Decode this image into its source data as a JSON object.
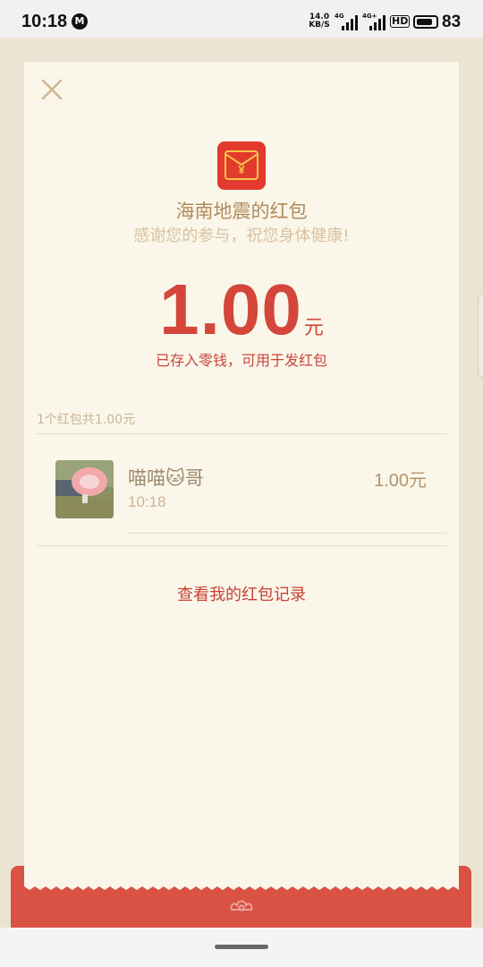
{
  "status_bar": {
    "time": "10:18",
    "app_icon_letter": "M",
    "net_speed_value": "14.0",
    "net_speed_unit": "KB/S",
    "sim1_tag": "4G",
    "sim2_tag": "4G+",
    "hd_label": "HD",
    "battery_level": 83,
    "battery_text": "83"
  },
  "red_packet": {
    "title": "海南地震的红包",
    "greeting": "感谢您的参与，祝您身体健康!",
    "amount": "1.00",
    "amount_unit": "元",
    "deposit_note": "已存入零钱，可用于发红包",
    "summary": "1个红包共1.00元"
  },
  "receivers": [
    {
      "name": "喵喵🐱哥",
      "time": "10:18",
      "amount": "1.00元"
    }
  ],
  "records_link": "查看我的红包记录",
  "colors": {
    "accent_red": "#d4463a",
    "paper": "#fbf6ea",
    "background": "#ece4d3",
    "gold_text": "#b08a5a"
  }
}
